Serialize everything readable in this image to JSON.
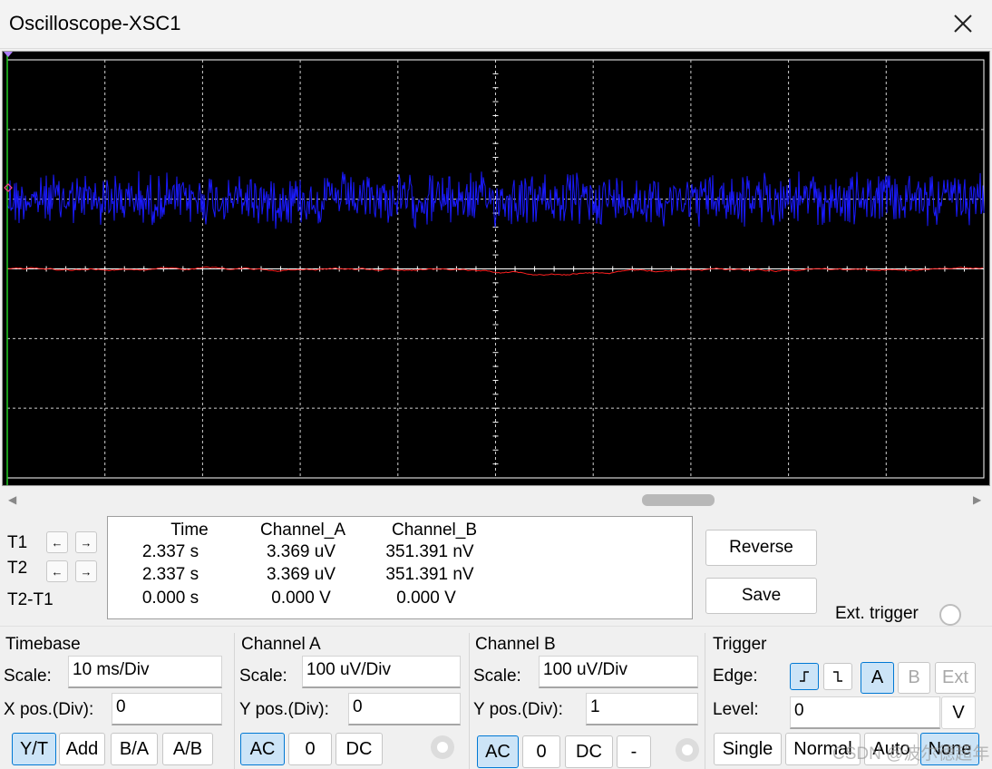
{
  "window": {
    "title": "Oscilloscope-XSC1"
  },
  "colors": {
    "channel_a": "#1a1aff",
    "channel_b": "#ff2020",
    "grid": "#ffffff",
    "screen_bg": "#000000",
    "selected_bg": "#cce4f7",
    "selected_border": "#0078d4"
  },
  "cursors": {
    "t1_label": "T1",
    "t2_label": "T2",
    "diff_label": "T2-T1",
    "left_arrow": "←",
    "right_arrow": "→",
    "headers": [
      "Time",
      "Channel_A",
      "Channel_B"
    ],
    "rows": [
      [
        "2.337 s",
        "3.369 uV",
        "351.391 nV"
      ],
      [
        "2.337 s",
        "3.369 uV",
        "351.391 nV"
      ],
      [
        "0.000 s",
        "0.000 V",
        "0.000 V"
      ]
    ]
  },
  "actions": {
    "reverse": "Reverse",
    "save": "Save",
    "ext_trigger": "Ext. trigger"
  },
  "timebase": {
    "title": "Timebase",
    "scale_label": "Scale:",
    "scale": "10 ms/Div",
    "xpos_label": "X pos.(Div):",
    "xpos": "0",
    "modes": [
      "Y/T",
      "Add",
      "B/A",
      "A/B"
    ],
    "selected_mode": "Y/T"
  },
  "channel_a": {
    "title": "Channel A",
    "scale_label": "Scale:",
    "scale": "100 uV/Div",
    "ypos_label": "Y pos.(Div):",
    "ypos": "0",
    "coupling": [
      "AC",
      "0",
      "DC"
    ],
    "selected": "AC"
  },
  "channel_b": {
    "title": "Channel B",
    "scale_label": "Scale:",
    "scale": "100 uV/Div",
    "ypos_label": "Y pos.(Div):",
    "ypos": "1",
    "coupling": [
      "AC",
      "0",
      "DC",
      "-"
    ],
    "selected": "AC"
  },
  "trigger": {
    "title": "Trigger",
    "edge_label": "Edge:",
    "sources": [
      "A",
      "B",
      "Ext"
    ],
    "selected_source": "A",
    "level_label": "Level:",
    "level": "0",
    "level_unit": "V",
    "modes": [
      "Single",
      "Normal",
      "Auto",
      "None"
    ],
    "selected_mode": "None"
  },
  "watermark": "CSDN @波尔德超年"
}
